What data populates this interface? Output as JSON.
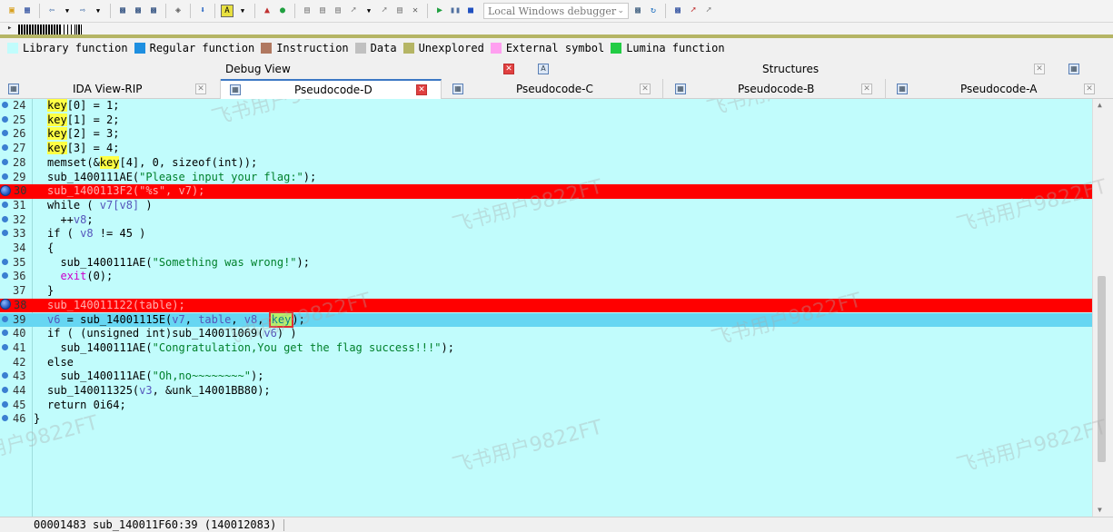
{
  "toolbar": {
    "debugger_label": "Local Windows debugger"
  },
  "legend": [
    {
      "label": "Library function",
      "color": "#c1fcfc"
    },
    {
      "label": "Regular function",
      "color": "#1e8fe0"
    },
    {
      "label": "Instruction",
      "color": "#b07860"
    },
    {
      "label": "Data",
      "color": "#c0c0c0"
    },
    {
      "label": "Unexplored",
      "color": "#b5b565"
    },
    {
      "label": "External symbol",
      "color": "#ff9ff0"
    },
    {
      "label": "Lumina function",
      "color": "#22cc44"
    }
  ],
  "tabs_top": [
    {
      "label": "Debug View"
    },
    {
      "label": "Structures"
    }
  ],
  "tabs_code": [
    {
      "label": "IDA View-RIP"
    },
    {
      "label": "Pseudocode-D"
    },
    {
      "label": "Pseudocode-C"
    },
    {
      "label": "Pseudocode-B"
    },
    {
      "label": "Pseudocode-A"
    }
  ],
  "line_numbers": [
    "24",
    "25",
    "26",
    "27",
    "28",
    "29",
    "30",
    "31",
    "32",
    "33",
    "34",
    "35",
    "36",
    "37",
    "38",
    "39",
    "40",
    "41",
    "42",
    "43",
    "44",
    "45",
    "46"
  ],
  "code": {
    "l24_rest": "[0] = 1;",
    "l25_rest": "[1] = 2;",
    "l26_rest": "[2] = 3;",
    "l27_rest": "[3] = 4;",
    "key": "key",
    "l28_a": "memset(&",
    "l28_b": "[4], 0, sizeof(int));",
    "l29_a": "sub_1400111AE(",
    "l29_str": "\"Please input your flag:\"",
    "l29_b": ");",
    "l30": "sub_1400113F2(\"%s\", v7);",
    "l31_a": "while ( ",
    "l31_var": "v7[v8]",
    "l31_b": " )",
    "l32_a": "  ++",
    "l32_var": "v8",
    "l32_b": ";",
    "l33_a": "if ( ",
    "l33_var": "v8",
    "l33_b": " != 45 )",
    "l34": "{",
    "l35_a": "  sub_1400111AE(",
    "l35_str": "\"Something was wrong!\"",
    "l35_b": ");",
    "l36_fn": "exit",
    "l36_b": "(0);",
    "l37": "}",
    "l38": "sub_140011122(table);",
    "l39_a": "v6",
    "l39_b": " = sub_14001115E(",
    "l39_c": "v7",
    "l39_d": ", ",
    "l39_e": "table",
    "l39_f": ", ",
    "l39_g": "v8",
    "l39_h": ", ",
    "l39_key": "key",
    "l39_i": ");",
    "l40_a": "if ( (unsigned int)sub_140011069(",
    "l40_var": "v6",
    "l40_b": ") )",
    "l41_a": "  sub_1400111AE(",
    "l41_str": "\"Congratulation,You get the flag success!!!\"",
    "l41_b": ");",
    "l42": "else",
    "l43_a": "  sub_1400111AE(",
    "l43_str": "\"Oh,no~~~~~~~~\"",
    "l43_b": ");",
    "l44_a": "sub_140011325(",
    "l44_var": "v3",
    "l44_b": ", &unk_14001BB80);",
    "l45": "return 0i64;",
    "l46": "}"
  },
  "status": {
    "address": "00001483 sub_140011F60:39 (140012083)"
  },
  "watermark": "飞书用户9822FT"
}
